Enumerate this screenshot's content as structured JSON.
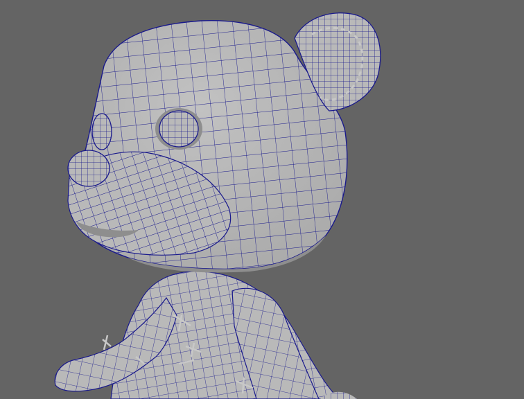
{
  "viewport": {
    "background": "#646464",
    "mesh_fill": "#b9b9b9",
    "mesh_shadow": "#8e8e8e",
    "wire_color": "#1a1a8c",
    "stitch_color": "#c8c8c8"
  }
}
